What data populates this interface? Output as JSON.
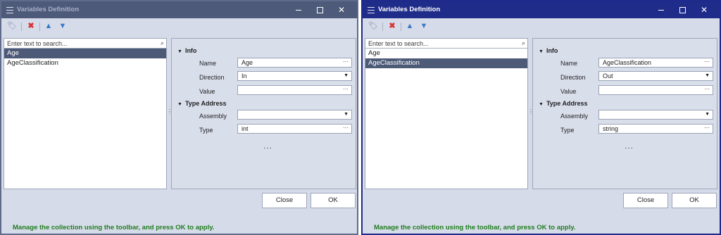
{
  "dialogs": [
    {
      "title": "Variables Definition",
      "toolbar": {
        "icons": [
          "tag-icon",
          "delete-icon",
          "arrow-up-icon",
          "arrow-down-icon"
        ]
      },
      "search": {
        "placeholder": "Enter text to search..."
      },
      "items": [
        {
          "label": "Age",
          "selected": true
        },
        {
          "label": "AgeClassification",
          "selected": false
        }
      ],
      "props": {
        "info_label": "Info",
        "name_label": "Name",
        "name_value": "Age",
        "direction_label": "Direction",
        "direction_value": "In",
        "value_label": "Value",
        "value_value": "",
        "type_address_label": "Type Address",
        "assembly_label": "Assembly",
        "assembly_value": "",
        "type_label": "Type",
        "type_value": "int"
      },
      "buttons": {
        "close": "Close",
        "ok": "OK"
      },
      "status": "Manage the collection using the toolbar, and press OK to apply."
    },
    {
      "title": "Variables Definition",
      "toolbar": {
        "icons": [
          "tag-icon",
          "delete-icon",
          "arrow-up-icon",
          "arrow-down-icon"
        ]
      },
      "search": {
        "placeholder": "Enter text to search..."
      },
      "items": [
        {
          "label": "Age",
          "selected": false
        },
        {
          "label": "AgeClassification",
          "selected": true
        }
      ],
      "props": {
        "info_label": "Info",
        "name_label": "Name",
        "name_value": "AgeClassification",
        "direction_label": "Direction",
        "direction_value": "Out",
        "value_label": "Value",
        "value_value": "",
        "type_address_label": "Type Address",
        "assembly_label": "Assembly",
        "assembly_value": "",
        "type_label": "Type",
        "type_value": "string"
      },
      "buttons": {
        "close": "Close",
        "ok": "OK"
      },
      "status": "Manage the collection using the toolbar, and press OK to apply."
    }
  ]
}
